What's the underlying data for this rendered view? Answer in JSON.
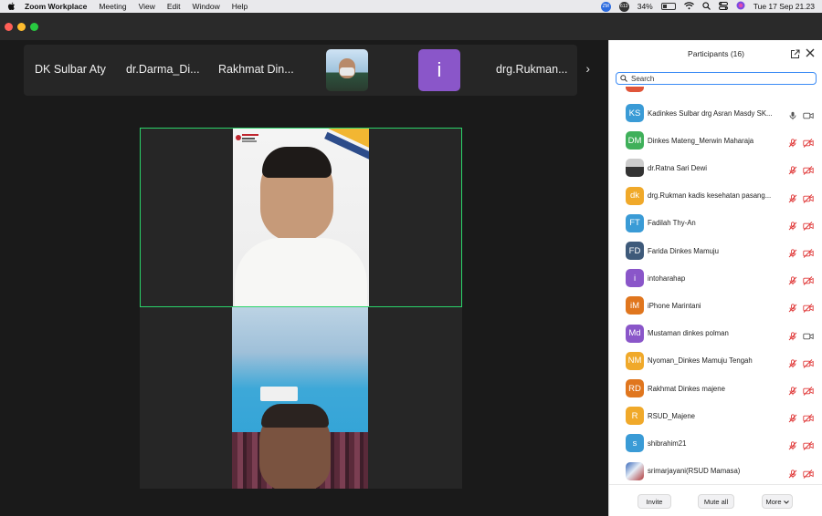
{
  "menubar": {
    "app_name": "Zoom Workplace",
    "items": [
      "Meeting",
      "View",
      "Edit",
      "Window",
      "Help"
    ],
    "status_badges": [
      "ZM",
      "613"
    ],
    "battery": "34%",
    "battery_level": 0.34,
    "datetime": "Tue 17 Sep  21.23"
  },
  "strip": {
    "names": [
      "DK Sulbar Aty",
      "dr.Darma_Di...",
      "Rakhmat Din..."
    ],
    "thumb_letter": "i",
    "last_name": "drg.Rukman...",
    "next_arrow": "›"
  },
  "panel": {
    "title": "Participants (16)",
    "search_placeholder": "Search",
    "participants": [
      {
        "initials": "KS",
        "name": "Kadinkes Sulbar drg Asran Masdy SK...",
        "color": "#3a9bd6",
        "mic": "on",
        "cam": "on"
      },
      {
        "initials": "DM",
        "name": "Dinkes Mateng_Merwin Maharaja",
        "color": "#3fb05a",
        "mic": "muted",
        "cam": "off"
      },
      {
        "initials": "",
        "name": "dr.Ratna Sari Dewi",
        "color": "#666666",
        "photo": "photo",
        "mic": "muted",
        "cam": "off"
      },
      {
        "initials": "dk",
        "name": "drg.Rukman kadis kesehatan pasang...",
        "color": "#f0a92a",
        "mic": "muted",
        "cam": "off"
      },
      {
        "initials": "FT",
        "name": "Fadilah Thy-An",
        "color": "#3a9bd6",
        "mic": "muted",
        "cam": "off"
      },
      {
        "initials": "FD",
        "name": "Farida Dinkes Mamuju",
        "color": "#3e5a7a",
        "mic": "muted",
        "cam": "off"
      },
      {
        "initials": "i",
        "name": "intoharahap",
        "color": "#8a56c9",
        "mic": "muted",
        "cam": "off"
      },
      {
        "initials": "iM",
        "name": "iPhone Marintani",
        "color": "#e0761e",
        "mic": "muted",
        "cam": "off"
      },
      {
        "initials": "Md",
        "name": "Mustaman dinkes polman",
        "color": "#8a56c9",
        "mic": "muted",
        "cam": "on"
      },
      {
        "initials": "NM",
        "name": "Nyoman_Dinkes Mamuju Tengah",
        "color": "#f0a92a",
        "mic": "muted",
        "cam": "off"
      },
      {
        "initials": "RD",
        "name": "Rakhmat Dinkes majene",
        "color": "#e0761e",
        "mic": "muted",
        "cam": "off"
      },
      {
        "initials": "R",
        "name": "RSUD_Majene",
        "color": "#f0a92a",
        "mic": "muted",
        "cam": "off"
      },
      {
        "initials": "s",
        "name": "shibrahim21",
        "color": "#3a9bd6",
        "mic": "muted",
        "cam": "off"
      },
      {
        "initials": "",
        "name": "srimarjayani(RSUD Mamasa)",
        "color": "#3565b8",
        "photo": "photo2",
        "mic": "muted",
        "cam": "off"
      }
    ],
    "footer": {
      "invite": "Invite",
      "mute_all": "Mute all",
      "more": "More"
    }
  },
  "colors": {
    "active_speaker_border": "#2bd46a",
    "search_focus": "#3b8bf5",
    "muted_red": "#e03a3a"
  }
}
